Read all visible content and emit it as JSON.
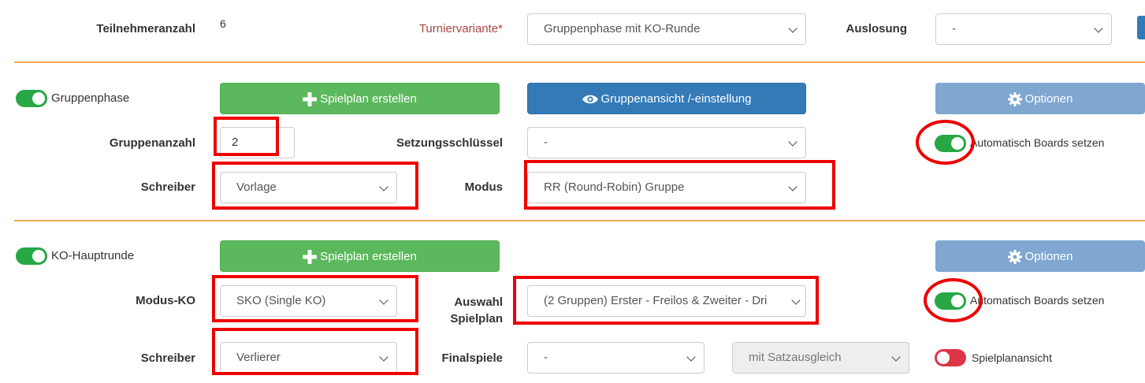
{
  "top": {
    "participants_label": "Teilnehmeranzahl",
    "participants_value": "6",
    "variant_label": "Turniervariante",
    "variant_required_mark": "*",
    "variant_value": "Gruppenphase mit KO-Runde",
    "draw_label": "Auslosung",
    "draw_value": "-"
  },
  "group_phase": {
    "toggle_label": "Gruppenphase",
    "toggle_state": "on",
    "create_plan_button": "Spielplan erstellen",
    "group_view_button": "Gruppenansicht /-einstellung",
    "options_button": "Optionen",
    "group_count_label": "Gruppenanzahl",
    "group_count_value": "2",
    "seeding_key_label": "Setzungsschlüssel",
    "seeding_key_value": "-",
    "auto_boards_label": "Automatisch Boards setzen",
    "auto_boards_state": "on",
    "writer_label": "Schreiber",
    "writer_value": "Vorlage",
    "mode_label": "Modus",
    "mode_value": "RR (Round-Robin) Gruppe"
  },
  "ko_main_round": {
    "toggle_label": "KO-Hauptrunde",
    "toggle_state": "on",
    "create_plan_button": "Spielplan erstellen",
    "options_button": "Optionen",
    "mode_ko_label": "Modus-KO",
    "mode_ko_value": "SKO (Single KO)",
    "plan_select_label_line1": "Auswahl",
    "plan_select_label_line2": "Spielplan",
    "plan_select_value": "(2 Gruppen) Erster - Freilos & Zweiter - Dri",
    "auto_boards_label": "Automatisch Boards setzen",
    "auto_boards_state": "on",
    "writer_label": "Schreiber",
    "writer_value": "Verlierer",
    "finals_label": "Finalspiele",
    "finals_value": "-",
    "set_balance_value": "mit Satzausgleich",
    "plan_view_label": "Spielplanansicht",
    "plan_view_state": "off"
  },
  "colors": {
    "green_button": "#5cb85c",
    "blue_button": "#337ab7",
    "light_blue_button": "#7fa7d0",
    "divider": "#f0ad4e",
    "toggle_on": "#28a745",
    "toggle_off": "#dc3545",
    "annotation": "#ee0000"
  }
}
